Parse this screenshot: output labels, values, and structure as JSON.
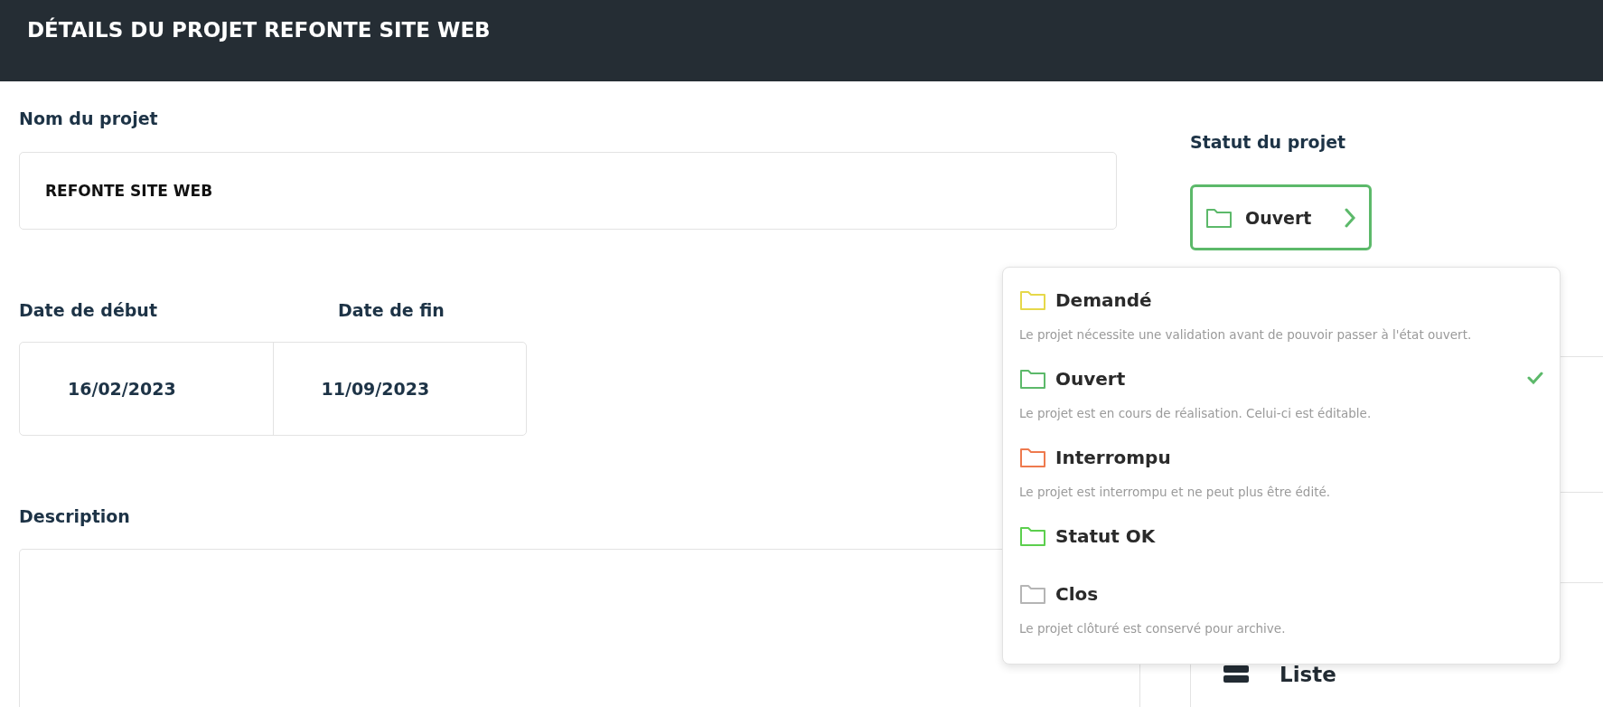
{
  "header": {
    "title": "DÉTAILS DU PROJET REFONTE SITE WEB"
  },
  "name_field": {
    "label": "Nom du projet",
    "value": "REFONTE SITE WEB"
  },
  "dates": {
    "start_label": "Date de début",
    "end_label": "Date de fin",
    "start": "16/02/2023",
    "end": "11/09/2023"
  },
  "description": {
    "label": "Description"
  },
  "status": {
    "label": "Statut du projet",
    "value": "Ouvert",
    "color": "#5cb96a",
    "expanded": true
  },
  "status_options": [
    {
      "label": "Demandé",
      "description": "Le projet nécessite une validation avant de pouvoir passer à l'état ouvert.",
      "color": "#e6d84a",
      "selected": false
    },
    {
      "label": "Ouvert",
      "description": "Le projet est en cours de réalisation. Celui-ci est éditable.",
      "color": "#5cb96a",
      "selected": true
    },
    {
      "label": "Interrompu",
      "description": "Le projet est interrompu et ne peut plus être édité.",
      "color": "#ee7a4e",
      "selected": false
    },
    {
      "label": "Statut OK",
      "color": "#5ccf4e",
      "selected": false
    },
    {
      "label": "Clos",
      "description": "Le projet clôturé est conservé pour archive.",
      "color": "#b5b5b5",
      "selected": false
    }
  ],
  "side_panel": {
    "view_label": "Liste"
  }
}
